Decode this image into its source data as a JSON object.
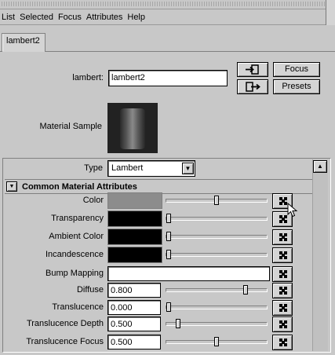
{
  "menu": [
    "List",
    "Selected",
    "Focus",
    "Attributes",
    "Help"
  ],
  "tab": {
    "label": "lambert2"
  },
  "header": {
    "node_label": "lambert:",
    "node_value": "lambert2",
    "focus_label": "Focus",
    "presets_label": "Presets",
    "swatch_label": "Material Sample"
  },
  "type_row": {
    "label": "Type",
    "value": "Lambert"
  },
  "section": {
    "title": "Common Material Attributes"
  },
  "attributes": [
    {
      "label": "Color",
      "kind": "color",
      "color": "#8c8c8c",
      "slider": 0.5
    },
    {
      "label": "Transparency",
      "kind": "color",
      "color": "#000000",
      "slider": 0.0
    },
    {
      "label": "Ambient Color",
      "kind": "color",
      "color": "#000000",
      "slider": 0.0
    },
    {
      "label": "Incandescence",
      "kind": "color",
      "color": "#000000",
      "slider": 0.0
    },
    {
      "label": "Bump Mapping",
      "kind": "text",
      "value": ""
    },
    {
      "label": "Diffuse",
      "kind": "number",
      "value": "0.800",
      "slider": 0.8
    },
    {
      "label": "Translucence",
      "kind": "number",
      "value": "0.000",
      "slider": 0.0
    },
    {
      "label": "Translucence Depth",
      "kind": "number",
      "value": "0.500",
      "slider": 0.1
    },
    {
      "label": "Translucence Focus",
      "kind": "number",
      "value": "0.500",
      "slider": 0.5
    }
  ],
  "icons": {
    "input_connection": "arrow-into-box-icon",
    "output_connection": "arrow-out-of-box-icon",
    "map_button": "checker-map-icon",
    "collapse": "triangle-down-icon",
    "scroll_up": "triangle-up-icon",
    "cursor": "mouse-pointer-icon"
  }
}
